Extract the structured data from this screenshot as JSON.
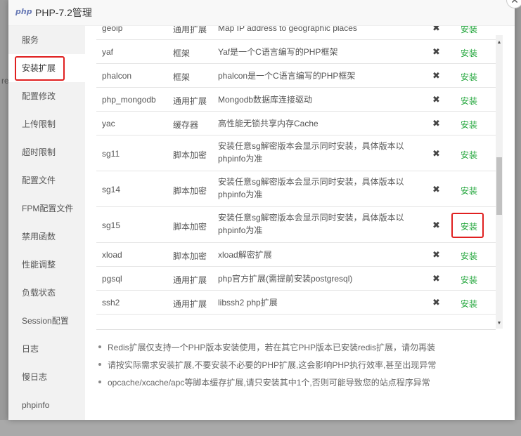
{
  "window": {
    "title": "PHP-7.2管理",
    "logo_text": "php",
    "close_symbol": "✕"
  },
  "background_fragment": "re",
  "sidebar": {
    "active_index": 1,
    "items": [
      {
        "label": "服务"
      },
      {
        "label": "安装扩展"
      },
      {
        "label": "配置修改"
      },
      {
        "label": "上传限制"
      },
      {
        "label": "超时限制"
      },
      {
        "label": "配置文件"
      },
      {
        "label": "FPM配置文件"
      },
      {
        "label": "禁用函数"
      },
      {
        "label": "性能调整"
      },
      {
        "label": "负载状态"
      },
      {
        "label": "Session配置"
      },
      {
        "label": "日志"
      },
      {
        "label": "慢日志"
      },
      {
        "label": "phpinfo"
      }
    ]
  },
  "extensions": [
    {
      "name": "geoip",
      "type": "通用扩展",
      "desc": "Map IP address to geographic places",
      "status": "✖",
      "action": "安装"
    },
    {
      "name": "yaf",
      "type": "框架",
      "desc": "Yaf是一个C语言编写的PHP框架",
      "status": "✖",
      "action": "安装"
    },
    {
      "name": "phalcon",
      "type": "框架",
      "desc": "phalcon是一个C语言编写的PHP框架",
      "status": "✖",
      "action": "安装"
    },
    {
      "name": "php_mongodb",
      "type": "通用扩展",
      "desc": "Mongodb数据库连接驱动",
      "status": "✖",
      "action": "安装"
    },
    {
      "name": "yac",
      "type": "缓存器",
      "desc": "高性能无锁共享内存Cache",
      "status": "✖",
      "action": "安装"
    },
    {
      "name": "sg11",
      "type": "脚本加密",
      "desc": "安装任意sg解密版本会显示同时安装，具体版本以phpinfo为准",
      "status": "✖",
      "action": "安装"
    },
    {
      "name": "sg14",
      "type": "脚本加密",
      "desc": "安装任意sg解密版本会显示同时安装，具体版本以phpinfo为准",
      "status": "✖",
      "action": "安装"
    },
    {
      "name": "sg15",
      "type": "脚本加密",
      "desc": "安装任意sg解密版本会显示同时安装，具体版本以phpinfo为准",
      "status": "✖",
      "action": "安装"
    },
    {
      "name": "xload",
      "type": "脚本加密",
      "desc": "xload解密扩展",
      "status": "✖",
      "action": "安装"
    },
    {
      "name": "pgsql",
      "type": "通用扩展",
      "desc": "php官方扩展(需提前安装postgresql)",
      "status": "✖",
      "action": "安装"
    },
    {
      "name": "ssh2",
      "type": "通用扩展",
      "desc": "libssh2 php扩展",
      "status": "✖",
      "action": "安装"
    }
  ],
  "notes": [
    "Redis扩展仅支持一个PHP版本安装使用，若在其它PHP版本已安装redis扩展，请勿再装",
    "请按实际需求安装扩展,不要安装不必要的PHP扩展,这会影响PHP执行效率,甚至出现异常",
    "opcache/xcache/apc等脚本缓存扩展,请只安装其中1个,否则可能导致您的站点程序异常"
  ],
  "colors": {
    "accent_green": "#20a53a",
    "highlight_red": "#e02020"
  }
}
